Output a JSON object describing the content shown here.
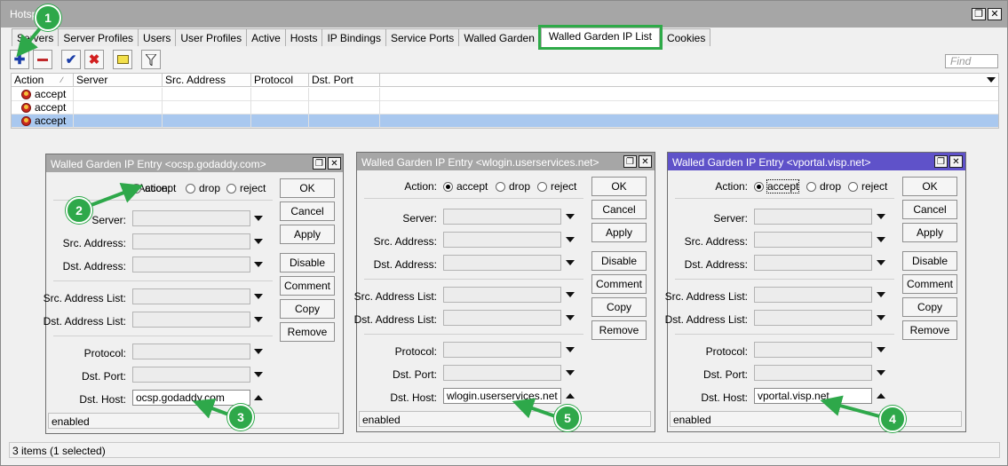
{
  "window": {
    "title": "Hotspot",
    "restore_icon": "restore-icon",
    "close_icon": "close-icon"
  },
  "tabs": [
    "Servers",
    "Server Profiles",
    "Users",
    "User Profiles",
    "Active",
    "Hosts",
    "IP Bindings",
    "Service Ports",
    "Walled Garden",
    "Walled Garden IP List",
    "Cookies"
  ],
  "active_tab": "Walled Garden IP List",
  "toolbar": {
    "icons": [
      "add-icon",
      "remove-icon",
      "enable-icon",
      "disable-icon",
      "comment-icon",
      "filter-icon"
    ],
    "find_placeholder": "Find"
  },
  "table": {
    "columns": [
      "Action",
      "Server",
      "Src. Address",
      "Protocol",
      "Dst. Port"
    ],
    "rows": [
      {
        "action": "accept",
        "selected": false
      },
      {
        "action": "accept",
        "selected": false
      },
      {
        "action": "accept",
        "selected": true
      }
    ]
  },
  "status": "3 items (1 selected)",
  "dialog_labels": {
    "action": "Action:",
    "accept": "accept",
    "drop": "drop",
    "reject": "reject",
    "server": "Server:",
    "src_address": "Src. Address:",
    "dst_address": "Dst. Address:",
    "src_address_list": "Src. Address List:",
    "dst_address_list": "Dst. Address List:",
    "protocol": "Protocol:",
    "dst_port": "Dst. Port:",
    "dst_host": "Dst. Host:"
  },
  "dialog_buttons": [
    "OK",
    "Cancel",
    "Apply",
    "Disable",
    "Comment",
    "Copy",
    "Remove"
  ],
  "dialogs": [
    {
      "title": "Walled Garden IP Entry <ocsp.godaddy.com>",
      "dst_host": "ocsp.godaddy.com",
      "status": "enabled",
      "action": "accept"
    },
    {
      "title": "Walled Garden IP Entry <wlogin.userservices.net>",
      "dst_host": "wlogin.userservices.net",
      "status": "enabled",
      "action": "accept"
    },
    {
      "title": "Walled Garden IP Entry <vportal.visp.net>",
      "dst_host": "vportal.visp.net",
      "status": "enabled",
      "action": "accept"
    }
  ],
  "badges": [
    "1",
    "2",
    "3",
    "4",
    "5"
  ],
  "colors": {
    "annotation": "#2ea84a",
    "selection": "#a9c8ef",
    "focused_title": "#5f52c9"
  }
}
